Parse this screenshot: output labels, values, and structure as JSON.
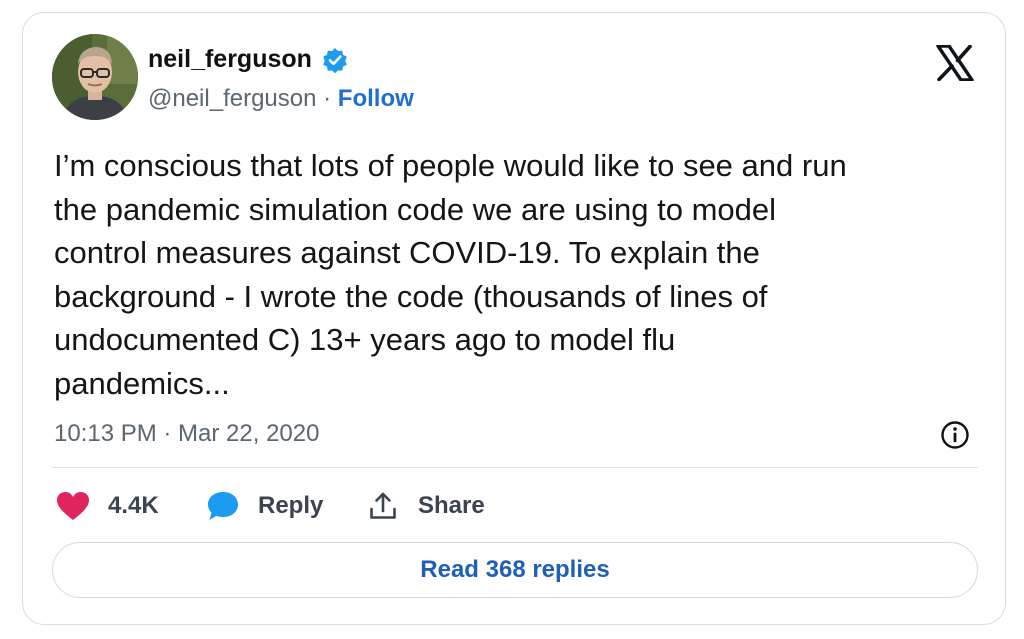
{
  "author": {
    "display_name": "neil_ferguson",
    "handle": "@neil_ferguson",
    "separator": " · ",
    "follow_label": "Follow",
    "avatar_icon": "profile-photo",
    "verified_icon": "verified-badge-icon"
  },
  "tweet": {
    "text": "I’m conscious that lots of people would like to see and run\nthe pandemic simulation code we are using to model\ncontrol measures against COVID-19.  To explain the\nbackground - I wrote the code (thousands of lines of\nundocumented C) 13+ years ago to model flu\npandemics...",
    "timestamp": "10:13 PM · Mar 22, 2020"
  },
  "actions": {
    "like_count": "4.4K",
    "reply_label": "Reply",
    "share_label": "Share"
  },
  "footer": {
    "read_replies_label": "Read 368 replies"
  },
  "colors": {
    "like": "#e0245e",
    "reply": "#1d9bf0",
    "follow": "#1f6fd1",
    "verified": "#1d9bf0"
  }
}
